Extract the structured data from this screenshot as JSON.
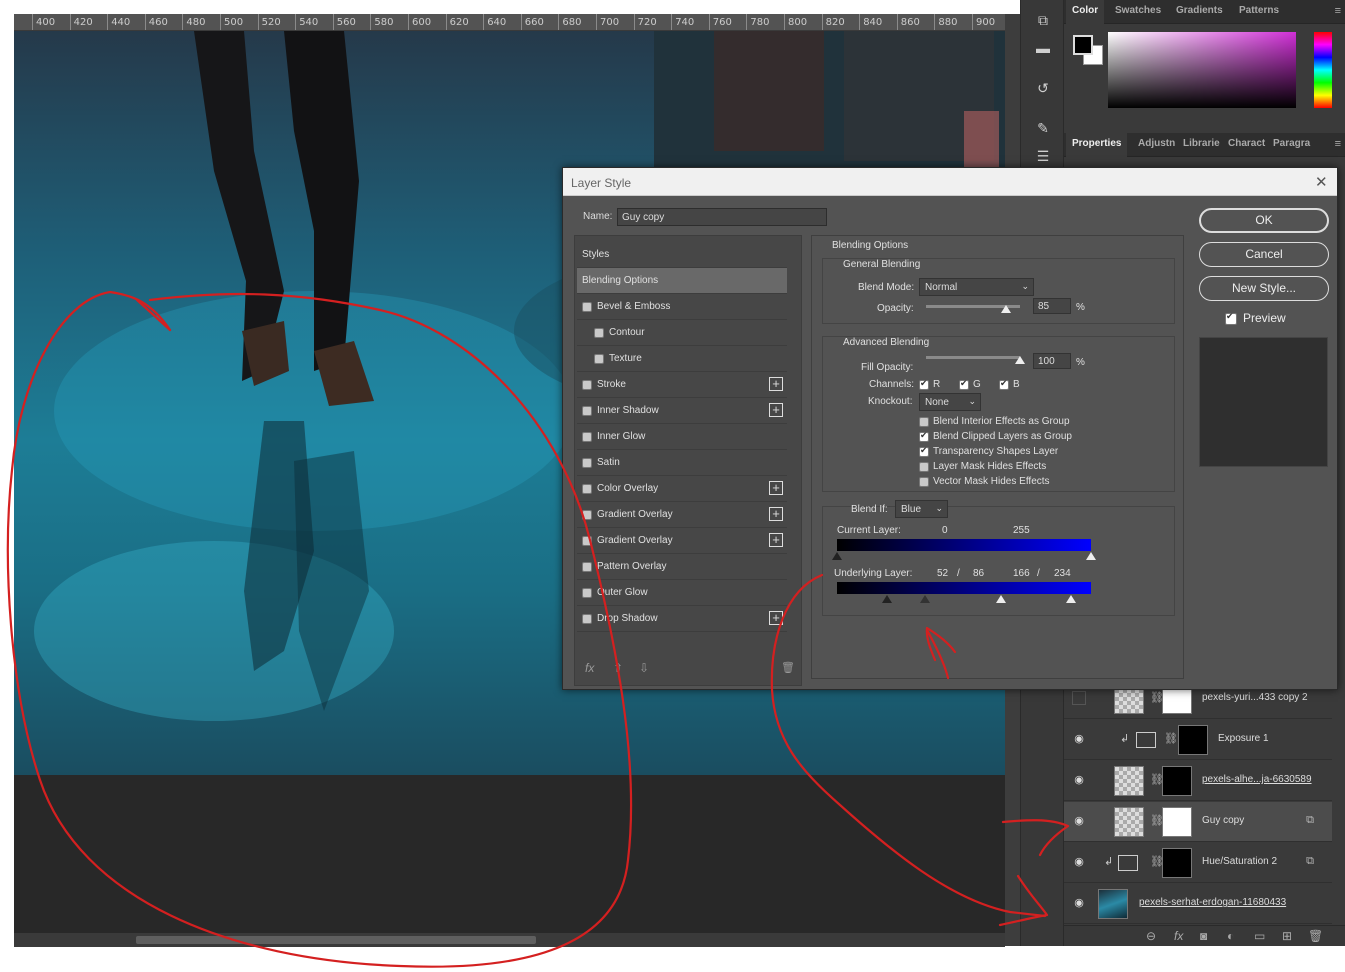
{
  "ruler": {
    "ticks": [
      "400",
      "420",
      "440",
      "460",
      "480",
      "500",
      "520",
      "540",
      "560",
      "580",
      "600",
      "620",
      "640",
      "660",
      "680",
      "700",
      "720",
      "740",
      "760",
      "780",
      "800",
      "820",
      "840",
      "860",
      "880",
      "900"
    ]
  },
  "color_panel": {
    "tabs": [
      "Color",
      "Swatches",
      "Gradients",
      "Patterns"
    ],
    "foreground": "#000000",
    "background": "#ffffff"
  },
  "props_panel": {
    "tabs": [
      "Properties",
      "Adjustn",
      "Librarie",
      "Charact",
      "Paragra"
    ]
  },
  "dialog": {
    "title": "Layer Style",
    "name_label": "Name:",
    "name_value": "Guy copy",
    "styles": [
      {
        "label": "Styles",
        "checkbox": false,
        "plus": false,
        "indent": 0
      },
      {
        "label": "Blending Options",
        "checkbox": false,
        "plus": false,
        "indent": 0,
        "selected": true
      },
      {
        "label": "Bevel & Emboss",
        "checkbox": true,
        "plus": false,
        "indent": 0
      },
      {
        "label": "Contour",
        "checkbox": true,
        "plus": false,
        "indent": 1
      },
      {
        "label": "Texture",
        "checkbox": true,
        "plus": false,
        "indent": 1
      },
      {
        "label": "Stroke",
        "checkbox": true,
        "plus": true,
        "indent": 0
      },
      {
        "label": "Inner Shadow",
        "checkbox": true,
        "plus": true,
        "indent": 0
      },
      {
        "label": "Inner Glow",
        "checkbox": true,
        "plus": false,
        "indent": 0
      },
      {
        "label": "Satin",
        "checkbox": true,
        "plus": false,
        "indent": 0
      },
      {
        "label": "Color Overlay",
        "checkbox": true,
        "plus": true,
        "indent": 0
      },
      {
        "label": "Gradient Overlay",
        "checkbox": true,
        "plus": true,
        "indent": 0
      },
      {
        "label": "Gradient Overlay",
        "checkbox": true,
        "plus": true,
        "indent": 0
      },
      {
        "label": "Pattern Overlay",
        "checkbox": true,
        "plus": false,
        "indent": 0
      },
      {
        "label": "Outer Glow",
        "checkbox": true,
        "plus": false,
        "indent": 0
      },
      {
        "label": "Drop Shadow",
        "checkbox": true,
        "plus": true,
        "indent": 0
      }
    ],
    "footer": {
      "fx": "fx",
      "up": "⇧",
      "down": "⇩",
      "trash": "🗑"
    },
    "blending": {
      "heading": "Blending Options",
      "general_heading": "General Blending",
      "blend_mode_label": "Blend Mode:",
      "blend_mode_value": "Normal",
      "opacity_label": "Opacity:",
      "opacity_value": "85",
      "opacity_fraction": 0.85,
      "percent": "%",
      "advanced_heading": "Advanced Blending",
      "fill_opacity_label": "Fill Opacity:",
      "fill_opacity_value": "100",
      "fill_opacity_fraction": 1.0,
      "channels_label": "Channels:",
      "channels": [
        {
          "label": "R",
          "checked": true
        },
        {
          "label": "G",
          "checked": true
        },
        {
          "label": "B",
          "checked": true
        }
      ],
      "knockout_label": "Knockout:",
      "knockout_value": "None",
      "options": [
        {
          "label": "Blend Interior Effects as Group",
          "checked": false
        },
        {
          "label": "Blend Clipped Layers as Group",
          "checked": true
        },
        {
          "label": "Transparency Shapes Layer",
          "checked": true
        },
        {
          "label": "Layer Mask Hides Effects",
          "checked": false
        },
        {
          "label": "Vector Mask Hides Effects",
          "checked": false
        }
      ],
      "blend_if_label": "Blend If:",
      "blend_if_value": "Blue",
      "current_layer_label": "Current Layer:",
      "current_low": "0",
      "current_high": "255",
      "underlying_label": "Underlying Layer:",
      "under_a": "52",
      "under_sep1": "/",
      "under_b": "86",
      "under_c": "166",
      "under_sep2": "/",
      "under_d": "234"
    },
    "buttons": {
      "ok": "OK",
      "cancel": "Cancel",
      "new_style": "New Style...",
      "preview": "Preview",
      "preview_checked": true
    }
  },
  "layers": [
    {
      "name": "pexels-yuri...433 copy 2",
      "visible": false,
      "clip": false,
      "thumb": "checker",
      "mask": "white",
      "underline": false,
      "fx": false
    },
    {
      "name": "Exposure 1",
      "visible": true,
      "clip": true,
      "thumb": "exposure-icon",
      "mask": "black",
      "underline": false,
      "fx": false
    },
    {
      "name": "pexels-alhe...ja-6630589",
      "visible": true,
      "clip": false,
      "thumb": "checker",
      "mask": "black",
      "underline": true,
      "fx": false
    },
    {
      "name": "Guy copy",
      "visible": true,
      "clip": false,
      "thumb": "checker",
      "mask": "white",
      "underline": false,
      "fx": true,
      "selected": true
    },
    {
      "name": "Hue/Saturation 2",
      "visible": true,
      "clip": true,
      "thumb": "huesat-icon",
      "mask": "black",
      "underline": false,
      "fx": true
    },
    {
      "name": "pexels-serhat-erdogan-11680433",
      "visible": true,
      "clip": false,
      "thumb": "photo",
      "mask": "none",
      "underline": true,
      "fx": false
    }
  ],
  "layer_bar_icons": [
    "link-icon",
    "fx-icon",
    "mask-icon",
    "adjustment-icon",
    "group-icon",
    "new-layer-icon",
    "delete-icon"
  ],
  "colors": {
    "annotation": "#d42020",
    "panel": "#3a3a3a",
    "dialog": "#535353"
  }
}
